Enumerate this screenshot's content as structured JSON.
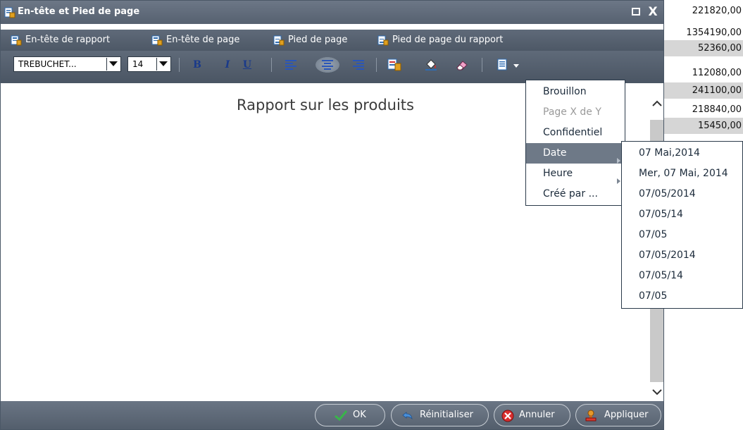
{
  "background_values": [
    "221820,00",
    "1354190,00",
    "52360,00",
    "112080,00",
    "241100,00",
    "218840,00",
    "15450,00"
  ],
  "dialog": {
    "title": "En-tête et Pied de page",
    "close_glyph": "X"
  },
  "nav": [
    {
      "label": "En-tête de rapport"
    },
    {
      "label": "En-tête de page"
    },
    {
      "label": "Pied de page"
    },
    {
      "label": "Pied de page du rapport"
    }
  ],
  "toolbar": {
    "font_value": "TREBUCHET...",
    "size_value": "14",
    "bold": "B",
    "italic": "I",
    "underline": "U"
  },
  "content": {
    "title": "Rapport sur les produits"
  },
  "menu": {
    "items": [
      {
        "label": "Brouillon",
        "state": "normal"
      },
      {
        "label": "Page X de Y",
        "state": "disabled"
      },
      {
        "label": "Confidentiel",
        "state": "normal"
      },
      {
        "label": "Date",
        "state": "active"
      },
      {
        "label": "Heure",
        "state": "normal"
      },
      {
        "label": "Créé par ...",
        "state": "normal"
      }
    ]
  },
  "submenu": {
    "items": [
      "07 Mai,2014",
      "Mer, 07 Mai, 2014",
      "07/05/2014",
      "07/05/14",
      "07/05",
      "07/05/2014",
      "07/05/14",
      "07/05"
    ]
  },
  "footer": {
    "ok": "OK",
    "reset": "Réinitialiser",
    "cancel": "Annuler",
    "apply": "Appliquer"
  },
  "colors": {
    "titlebar": "#5f6a79",
    "menu_active": "#6e7987",
    "accent_blue": "#1a3a8a"
  }
}
